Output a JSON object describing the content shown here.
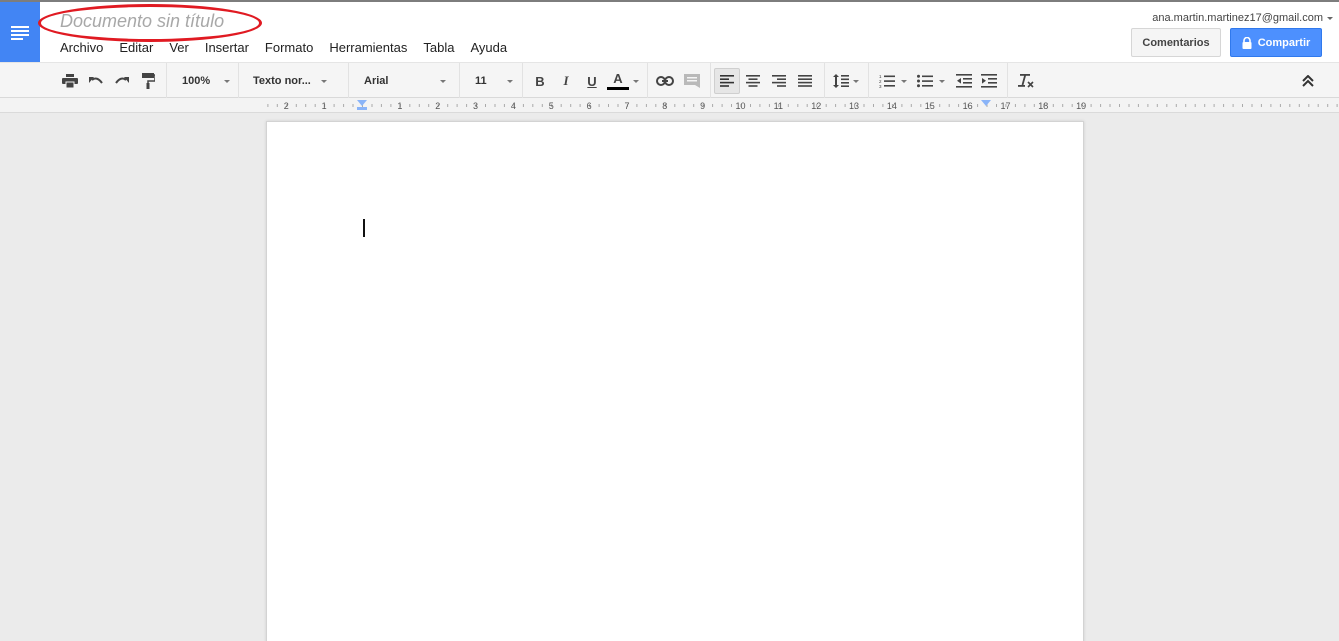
{
  "document": {
    "title_placeholder": "Documento sin título",
    "body_text": ""
  },
  "menu": [
    "Archivo",
    "Editar",
    "Ver",
    "Insertar",
    "Formato",
    "Herramientas",
    "Tabla",
    "Ayuda"
  ],
  "account": {
    "email": "ana.martin.martinez17@gmail.com"
  },
  "buttons": {
    "comments": "Comentarios",
    "share": "Compartir"
  },
  "toolbar": {
    "zoom": "100%",
    "style": "Texto nor...",
    "font": "Arial",
    "font_size": "11",
    "bold_label": "B",
    "italic_label": "I",
    "underline_label": "U",
    "text_color_label": "A",
    "active_alignment": "left",
    "icons": [
      "print-icon",
      "undo-icon",
      "redo-icon",
      "paint-format-icon",
      "bold-icon",
      "italic-icon",
      "underline-icon",
      "text-color-icon",
      "link-icon",
      "comment-icon",
      "align-left-icon",
      "align-center-icon",
      "align-right-icon",
      "justify-icon",
      "line-spacing-icon",
      "numbered-list-icon",
      "bulleted-list-icon",
      "decrease-indent-icon",
      "increase-indent-icon",
      "clear-formatting-icon",
      "collapse-toolbar-icon"
    ]
  },
  "ruler": {
    "labels": [
      "2",
      "1",
      "1",
      "2",
      "3",
      "4",
      "5",
      "6",
      "7",
      "8",
      "9",
      "10",
      "11",
      "12",
      "13",
      "14",
      "15",
      "16",
      "17",
      "18",
      "19"
    ]
  },
  "colors": {
    "accent": "#4285f4",
    "share_button": "#4d90fe",
    "title_highlight": "#e01a22",
    "text_color_swatch": "#000000"
  }
}
